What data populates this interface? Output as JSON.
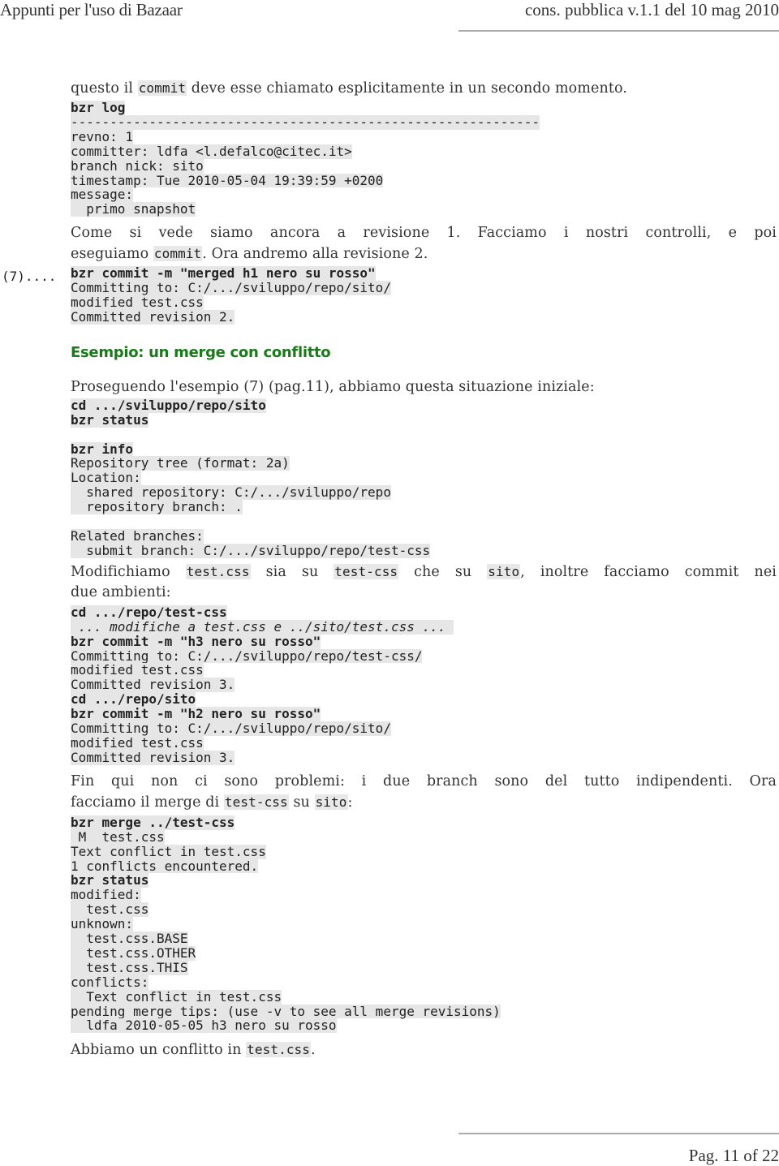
{
  "header": {
    "title": "Appunti per l'uso di Bazaar",
    "version": "cons. pubblica v.1.1 del 10 mag 2010"
  },
  "intro": {
    "text_before": "questo il ",
    "code": "commit",
    "text_after": " deve esse chiamato esplicitamente in un secondo momento."
  },
  "log_block": {
    "command": "bzr log",
    "separator": "------------------------------------------------------------",
    "lines": [
      "revno: 1",
      "committer: ldfa <l.defalco@citec.it>",
      "branch nick: sito",
      "timestamp: Tue 2010-05-04 19:39:59 +0200",
      "message:",
      "  primo snapshot"
    ]
  },
  "para1": {
    "line1": "Come si  vede siamo ancora a revisione 1. Facciamo i nostri controlli, e poi",
    "line2_before": "eseguiamo ",
    "line2_code": "commit",
    "line2_after": ". Ora andremo alla revisione 2."
  },
  "commit_block": {
    "marker": "(7)....",
    "command": "bzr commit -m \"merged h1 nero su rosso\"",
    "lines": [
      "Committing to: C:/.../sviluppo/repo/sito/",
      "modified test.css",
      "Committed revision 2."
    ]
  },
  "section": {
    "heading": "Esempio: un merge con conflitto"
  },
  "para2": {
    "text": "Proseguendo l'esempio (7) (pag.11), abbiamo questa situazione iniziale:"
  },
  "status_block": {
    "commands": [
      "cd .../sviluppo/repo/sito",
      "bzr status"
    ]
  },
  "info_block": {
    "command": "bzr info",
    "lines": [
      "Repository tree (format: 2a)",
      "Location:",
      "  shared repository: C:/.../sviluppo/repo",
      "  repository branch: ."
    ],
    "related": [
      "Related branches:",
      "  submit branch: C:/.../sviluppo/repo/test-css"
    ]
  },
  "para3": {
    "t1": "Modifichiamo ",
    "c1": "test.css",
    "t2": " sia su ",
    "c2": "test-css",
    "t3": " che su ",
    "c3": "sito",
    "t4": ", inoltre facciamo commit nei",
    "line2": "due ambienti:"
  },
  "modify_block": {
    "cmd1": "cd .../repo/test-css",
    "comment": " ... modifiche a test.css e ../sito/test.css ... ",
    "cmd2": "bzr commit -m \"h3 nero su rosso\"",
    "out1": [
      "Committing to: C:/.../sviluppo/repo/test-css/",
      "modified test.css",
      "Committed revision 3."
    ],
    "cmd3": "cd .../repo/sito",
    "cmd4": "bzr commit -m \"h2 nero su rosso\"",
    "out2": [
      "Committing to: C:/.../sviluppo/repo/sito/",
      "modified test.css",
      "Committed revision 3."
    ]
  },
  "para4": {
    "line1": "Fin qui non ci sono problemi: i due branch sono del tutto indipendenti. Ora",
    "t1": "facciamo il merge di ",
    "c1": "test-css",
    "t2": " su ",
    "c2": "sito",
    "t3": ":"
  },
  "merge_block": {
    "command": "bzr merge ../test-css",
    "lines": [
      " M  test.css",
      "Text conflict in test.css",
      "1 conflicts encountered."
    ],
    "command2": "bzr status",
    "status_lines": [
      "modified:",
      "  test.css",
      "unknown:",
      "  test.css.BASE",
      "  test.css.OTHER",
      "  test.css.THIS",
      "conflicts:",
      "  Text conflict in test.css",
      "pending merge tips: (use -v to see all merge revisions)",
      "  ldfa 2010-05-05 h3 nero su rosso"
    ]
  },
  "para5": {
    "t1": "Abbiamo un conflitto in ",
    "c1": "test.css",
    "t2": "."
  },
  "footer": {
    "page": "Pag. 11 of 22"
  }
}
